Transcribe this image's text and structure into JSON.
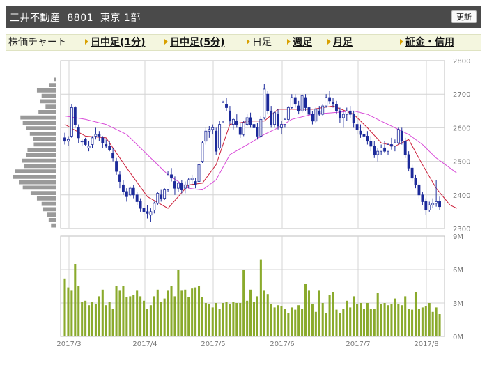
{
  "header": {
    "title": "三井不動産  8801  東京 1部",
    "refresh_label": "更新"
  },
  "tabs": [
    {
      "label": "株価チャート",
      "bold": false,
      "bullet": false
    },
    {
      "label": "日中足(1分)",
      "bold": true,
      "bullet": true
    },
    {
      "label": "日中足(5分)",
      "bold": true,
      "bullet": true
    },
    {
      "label": "日足",
      "bold": false,
      "bullet": true
    },
    {
      "label": "週足",
      "bold": true,
      "bullet": true
    },
    {
      "label": "月足",
      "bold": true,
      "bullet": true
    },
    {
      "label": "証金・信用",
      "bold": true,
      "bullet": true
    }
  ],
  "colors": {
    "candle_up": "#ffffff",
    "candle_down": "#1c2a9a",
    "short_ma": "#cc1f3a",
    "long_ma": "#d84ad8",
    "volume": "#8aaa2c",
    "volume_profile": "#9a9a9a",
    "grid": "#d4d4d4"
  },
  "chart_data": {
    "type": "candlestick",
    "price_axis": {
      "min": 2300,
      "max": 2800,
      "ticks": [
        "2300",
        "2400",
        "2500",
        "2600",
        "2700",
        "2800"
      ]
    },
    "volume_axis": {
      "min": 0,
      "max": 9,
      "ticks": [
        "0M",
        "3M",
        "6M",
        "9M"
      ]
    },
    "x_ticks": [
      "2017/3",
      "2017/4",
      "2017/5",
      "2017/6",
      "2017/7",
      "2017/8"
    ],
    "candles": [
      [
        2570,
        2585,
        2550,
        2560
      ],
      [
        2560,
        2575,
        2545,
        2565
      ],
      [
        2575,
        2670,
        2570,
        2660
      ],
      [
        2660,
        2665,
        2600,
        2610
      ],
      [
        2600,
        2610,
        2555,
        2570
      ],
      [
        2560,
        2565,
        2545,
        2560
      ],
      [
        2565,
        2570,
        2545,
        2550
      ],
      [
        2540,
        2560,
        2530,
        2545
      ],
      [
        2550,
        2575,
        2540,
        2570
      ],
      [
        2575,
        2600,
        2565,
        2580
      ],
      [
        2580,
        2590,
        2560,
        2575
      ],
      [
        2570,
        2575,
        2540,
        2555
      ],
      [
        2550,
        2565,
        2540,
        2545
      ],
      [
        2545,
        2560,
        2530,
        2535
      ],
      [
        2525,
        2540,
        2500,
        2510
      ],
      [
        2500,
        2510,
        2460,
        2470
      ],
      [
        2460,
        2470,
        2420,
        2440
      ],
      [
        2430,
        2445,
        2400,
        2410
      ],
      [
        2410,
        2420,
        2380,
        2395
      ],
      [
        2400,
        2425,
        2395,
        2420
      ],
      [
        2420,
        2430,
        2390,
        2400
      ],
      [
        2400,
        2410,
        2370,
        2380
      ],
      [
        2380,
        2390,
        2350,
        2360
      ],
      [
        2360,
        2375,
        2340,
        2350
      ],
      [
        2350,
        2370,
        2330,
        2345
      ],
      [
        2340,
        2360,
        2320,
        2350
      ],
      [
        2355,
        2380,
        2345,
        2375
      ],
      [
        2375,
        2410,
        2370,
        2405
      ],
      [
        2400,
        2415,
        2380,
        2390
      ],
      [
        2390,
        2420,
        2385,
        2415
      ],
      [
        2415,
        2470,
        2410,
        2460
      ],
      [
        2460,
        2480,
        2440,
        2450
      ],
      [
        2440,
        2455,
        2400,
        2420
      ],
      [
        2420,
        2440,
        2410,
        2435
      ],
      [
        2435,
        2445,
        2405,
        2415
      ],
      [
        2420,
        2440,
        2405,
        2430
      ],
      [
        2430,
        2450,
        2420,
        2445
      ],
      [
        2445,
        2460,
        2430,
        2450
      ],
      [
        2440,
        2450,
        2420,
        2430
      ],
      [
        2440,
        2500,
        2435,
        2490
      ],
      [
        2500,
        2560,
        2495,
        2555
      ],
      [
        2560,
        2600,
        2550,
        2590
      ],
      [
        2590,
        2605,
        2570,
        2595
      ],
      [
        2595,
        2610,
        2580,
        2600
      ],
      [
        2590,
        2600,
        2520,
        2530
      ],
      [
        2540,
        2620,
        2535,
        2610
      ],
      [
        2620,
        2680,
        2615,
        2675
      ],
      [
        2670,
        2690,
        2650,
        2660
      ],
      [
        2650,
        2665,
        2610,
        2620
      ],
      [
        2610,
        2630,
        2595,
        2625
      ],
      [
        2620,
        2640,
        2600,
        2610
      ],
      [
        2600,
        2615,
        2570,
        2580
      ],
      [
        2580,
        2620,
        2575,
        2615
      ],
      [
        2610,
        2640,
        2605,
        2630
      ],
      [
        2630,
        2645,
        2600,
        2610
      ],
      [
        2610,
        2625,
        2590,
        2600
      ],
      [
        2600,
        2615,
        2565,
        2575
      ],
      [
        2575,
        2635,
        2570,
        2625
      ],
      [
        2630,
        2730,
        2625,
        2715
      ],
      [
        2700,
        2710,
        2640,
        2650
      ],
      [
        2650,
        2665,
        2600,
        2610
      ],
      [
        2610,
        2650,
        2600,
        2645
      ],
      [
        2640,
        2655,
        2595,
        2605
      ],
      [
        2600,
        2620,
        2580,
        2610
      ],
      [
        2610,
        2630,
        2600,
        2625
      ],
      [
        2625,
        2665,
        2620,
        2660
      ],
      [
        2660,
        2700,
        2655,
        2690
      ],
      [
        2690,
        2700,
        2660,
        2670
      ],
      [
        2665,
        2680,
        2640,
        2650
      ],
      [
        2650,
        2700,
        2645,
        2695
      ],
      [
        2690,
        2700,
        2650,
        2660
      ],
      [
        2660,
        2670,
        2630,
        2640
      ],
      [
        2640,
        2650,
        2610,
        2620
      ],
      [
        2620,
        2660,
        2615,
        2655
      ],
      [
        2650,
        2665,
        2635,
        2640
      ],
      [
        2640,
        2670,
        2635,
        2665
      ],
      [
        2665,
        2700,
        2660,
        2690
      ],
      [
        2690,
        2710,
        2670,
        2680
      ],
      [
        2675,
        2690,
        2660,
        2670
      ],
      [
        2670,
        2680,
        2640,
        2650
      ],
      [
        2650,
        2660,
        2615,
        2630
      ],
      [
        2630,
        2650,
        2600,
        2640
      ],
      [
        2640,
        2660,
        2620,
        2650
      ],
      [
        2650,
        2665,
        2630,
        2640
      ],
      [
        2640,
        2650,
        2600,
        2615
      ],
      [
        2610,
        2625,
        2580,
        2595
      ],
      [
        2590,
        2610,
        2570,
        2580
      ],
      [
        2580,
        2600,
        2560,
        2575
      ],
      [
        2575,
        2590,
        2550,
        2560
      ],
      [
        2560,
        2575,
        2530,
        2545
      ],
      [
        2545,
        2560,
        2510,
        2520
      ],
      [
        2520,
        2540,
        2500,
        2530
      ],
      [
        2530,
        2550,
        2520,
        2540
      ],
      [
        2540,
        2560,
        2525,
        2530
      ],
      [
        2530,
        2555,
        2520,
        2550
      ],
      [
        2550,
        2570,
        2535,
        2545
      ],
      [
        2545,
        2565,
        2530,
        2555
      ],
      [
        2555,
        2600,
        2550,
        2595
      ],
      [
        2590,
        2600,
        2550,
        2560
      ],
      [
        2560,
        2570,
        2510,
        2520
      ],
      [
        2520,
        2530,
        2470,
        2480
      ],
      [
        2480,
        2490,
        2440,
        2450
      ],
      [
        2450,
        2460,
        2420,
        2430
      ],
      [
        2430,
        2440,
        2390,
        2400
      ],
      [
        2400,
        2410,
        2370,
        2380
      ],
      [
        2380,
        2390,
        2340,
        2355
      ],
      [
        2355,
        2380,
        2350,
        2370
      ],
      [
        2370,
        2390,
        2360,
        2375
      ],
      [
        2375,
        2445,
        2365,
        2380
      ],
      [
        2380,
        2395,
        2355,
        2365
      ]
    ],
    "short_ma": [
      [
        0,
        2610
      ],
      [
        6,
        2575
      ],
      [
        12,
        2570
      ],
      [
        18,
        2480
      ],
      [
        24,
        2395
      ],
      [
        30,
        2360
      ],
      [
        36,
        2430
      ],
      [
        40,
        2435
      ],
      [
        44,
        2490
      ],
      [
        48,
        2610
      ],
      [
        54,
        2620
      ],
      [
        58,
        2620
      ],
      [
        62,
        2655
      ],
      [
        66,
        2655
      ],
      [
        72,
        2655
      ],
      [
        78,
        2665
      ],
      [
        84,
        2640
      ],
      [
        88,
        2600
      ],
      [
        92,
        2555
      ],
      [
        96,
        2545
      ],
      [
        100,
        2565
      ],
      [
        104,
        2490
      ],
      [
        108,
        2420
      ],
      [
        112,
        2370
      ],
      [
        114,
        2360
      ]
    ],
    "long_ma": [
      [
        0,
        2635
      ],
      [
        6,
        2625
      ],
      [
        12,
        2610
      ],
      [
        18,
        2580
      ],
      [
        24,
        2520
      ],
      [
        30,
        2460
      ],
      [
        36,
        2420
      ],
      [
        40,
        2415
      ],
      [
        44,
        2445
      ],
      [
        48,
        2520
      ],
      [
        54,
        2555
      ],
      [
        58,
        2580
      ],
      [
        62,
        2600
      ],
      [
        66,
        2625
      ],
      [
        72,
        2640
      ],
      [
        78,
        2645
      ],
      [
        84,
        2650
      ],
      [
        88,
        2640
      ],
      [
        92,
        2620
      ],
      [
        96,
        2600
      ],
      [
        100,
        2580
      ],
      [
        104,
        2550
      ],
      [
        108,
        2510
      ],
      [
        112,
        2480
      ],
      [
        114,
        2465
      ]
    ],
    "volumes": [
      5.2,
      4.4,
      4.1,
      6.5,
      4.5,
      3.1,
      3.2,
      2.8,
      3.1,
      2.9,
      3.6,
      4.2,
      2.8,
      3.1,
      2.5,
      4.5,
      4.1,
      4.5,
      3.5,
      3.6,
      3.7,
      4.1,
      3.6,
      3.2,
      2.5,
      2.8,
      3.6,
      4.2,
      3.1,
      3.4,
      4.1,
      4.5,
      3.6,
      6.0,
      4.1,
      4.2,
      3.5,
      4.3,
      4.4,
      4.5,
      3.5,
      3.0,
      2.9,
      2.6,
      3.0,
      2.5,
      3.0,
      3.1,
      2.9,
      3.1,
      3.0,
      3.0,
      6.0,
      3.2,
      4.2,
      3.1,
      3.6,
      6.9,
      4.1,
      3.8,
      2.9,
      2.6,
      2.8,
      2.7,
      2.5,
      2.1,
      2.6,
      2.4,
      2.8,
      2.5,
      4.7,
      4.1,
      2.9,
      2.2,
      4.1,
      3.0,
      2.1,
      3.7,
      4.0,
      2.4,
      2.1,
      2.5,
      3.2,
      2.6,
      3.6,
      2.9,
      3.0,
      2.5,
      3.0,
      2.5,
      2.5,
      3.9,
      2.9,
      3.0,
      2.8,
      2.9,
      3.4,
      2.9,
      2.8,
      3.6,
      2.5,
      2.4,
      4.0,
      2.5,
      2.6,
      2.7,
      3.0,
      2.2,
      2.6,
      2.0,
      3.0,
      2.6,
      2.5,
      2.7,
      4.6
    ],
    "volume_profile": [
      2,
      8,
      24,
      18,
      20,
      13,
      22,
      45,
      42,
      38,
      33,
      29,
      28,
      36,
      38,
      43,
      40,
      52,
      55,
      47,
      42,
      32,
      24,
      18,
      16,
      11,
      9,
      6
    ]
  }
}
